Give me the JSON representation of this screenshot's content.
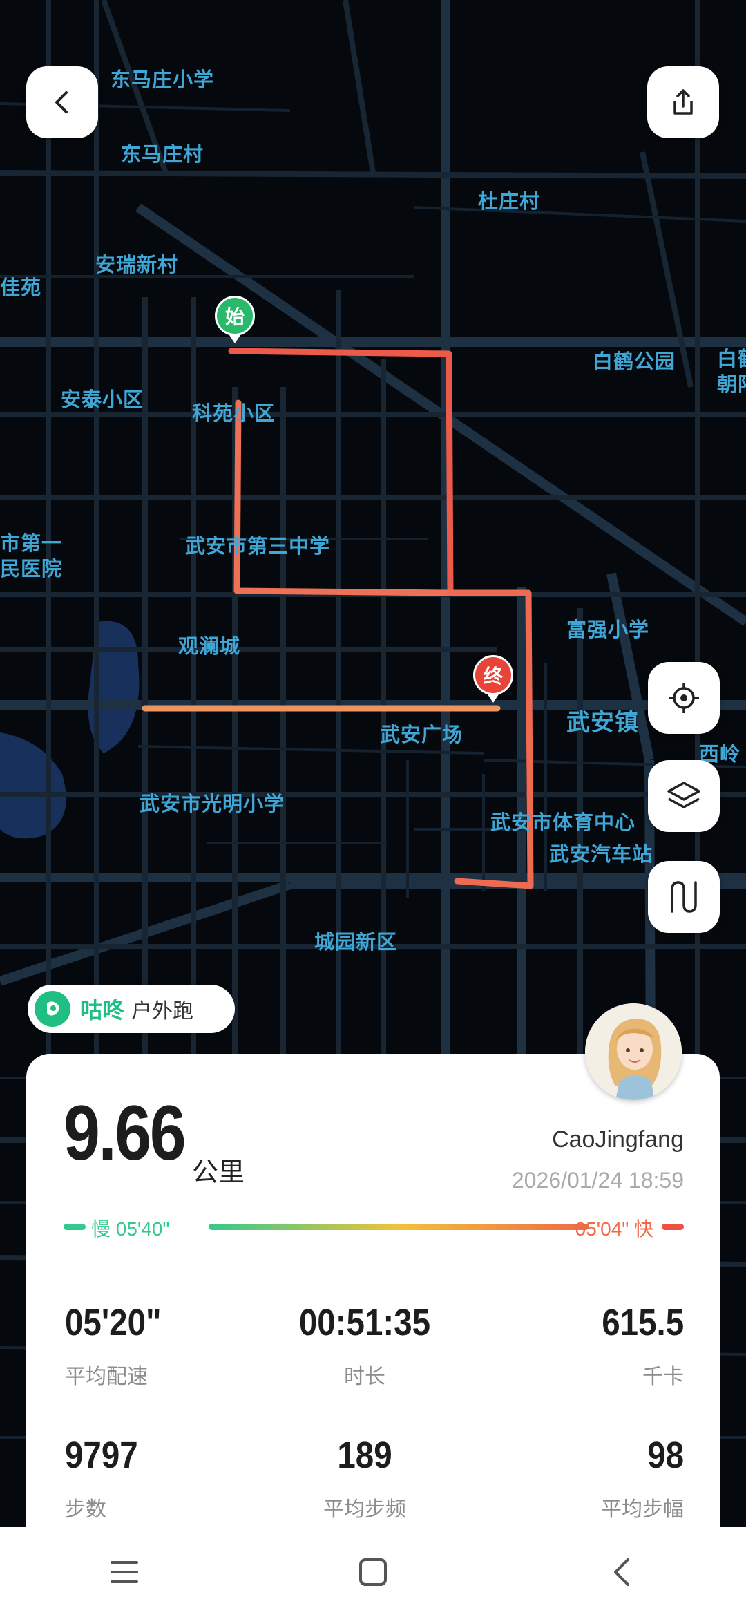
{
  "map": {
    "labels": [
      "东马庄小学",
      "东马庄村",
      "杜庄村",
      "安瑞新村",
      "佳苑",
      "安泰小区",
      "科苑小区",
      "白鹤公园",
      "白鹤",
      "朝阳",
      "市第一",
      "民医院",
      "武安市第三中学",
      "观澜城",
      "富强小学",
      "武安镇",
      "武安广场",
      "西岭",
      "武安市光明小学",
      "武安市体育中心",
      "武安汽车站",
      "城园新区"
    ],
    "start_marker": "始",
    "end_marker": "终"
  },
  "toolbar": {
    "back_icon": "chevron-left-icon",
    "share_icon": "share-icon",
    "locate_icon": "locate-icon",
    "layers_icon": "layers-icon",
    "route_icon": "route-icon"
  },
  "source": {
    "brand": "咕咚",
    "type": "户外跑"
  },
  "summary": {
    "distance": "9.66",
    "distance_unit": "公里",
    "user_name": "CaoJingfang",
    "datetime": "2026/01/24 18:59",
    "pace_slow_label": "慢 05'40\"",
    "pace_fast_label": "05'04\" 快",
    "colors": {
      "slow": "#33c98b",
      "mid": "#f0c23a",
      "fast": "#ef5040"
    }
  },
  "stats": [
    {
      "value": "05'20\"",
      "label": "平均配速"
    },
    {
      "value": "00:51:35",
      "label": "时长"
    },
    {
      "value": "615.5",
      "label": "千卡"
    },
    {
      "value": "9797",
      "label": "步数"
    },
    {
      "value": "189",
      "label": "平均步频"
    },
    {
      "value": "98",
      "label": "平均步幅"
    }
  ],
  "navbar": {
    "menu_icon": "menu-icon",
    "home_icon": "home-icon",
    "back_icon": "back-icon"
  }
}
